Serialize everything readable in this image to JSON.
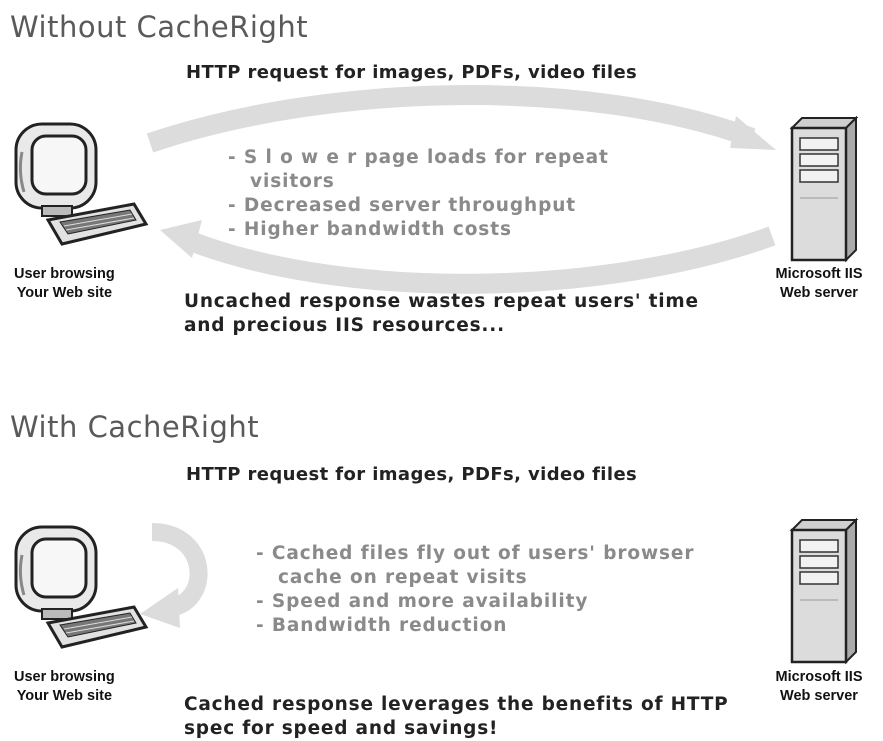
{
  "without": {
    "title": "Without CacheRight",
    "request": "HTTP request for images, PDFs, video files",
    "bullets": [
      "- S l o w e r page loads for repeat visitors",
      "- Decreased server throughput",
      "- Higher bandwidth costs"
    ],
    "response": "Uncached response wastes repeat users' time and precious IIS resources...",
    "client_label": [
      "User browsing",
      "Your Web site"
    ],
    "server_label": [
      "Microsoft IIS",
      "Web server"
    ]
  },
  "with": {
    "title": "With CacheRight",
    "request": "HTTP request for images, PDFs, video files",
    "bullets": [
      "- Cached files fly out of users' browser cache on repeat visits",
      "- Speed and more availability",
      "- Bandwidth reduction"
    ],
    "response": "Cached response leverages the benefits of HTTP spec for speed and savings!",
    "client_label": [
      "User browsing",
      "Your Web site"
    ],
    "server_label": [
      "Microsoft IIS",
      "Web server"
    ]
  },
  "icons": [
    "computer-icon",
    "server-icon",
    "arrow-icon",
    "curved-return-arrow-icon"
  ]
}
